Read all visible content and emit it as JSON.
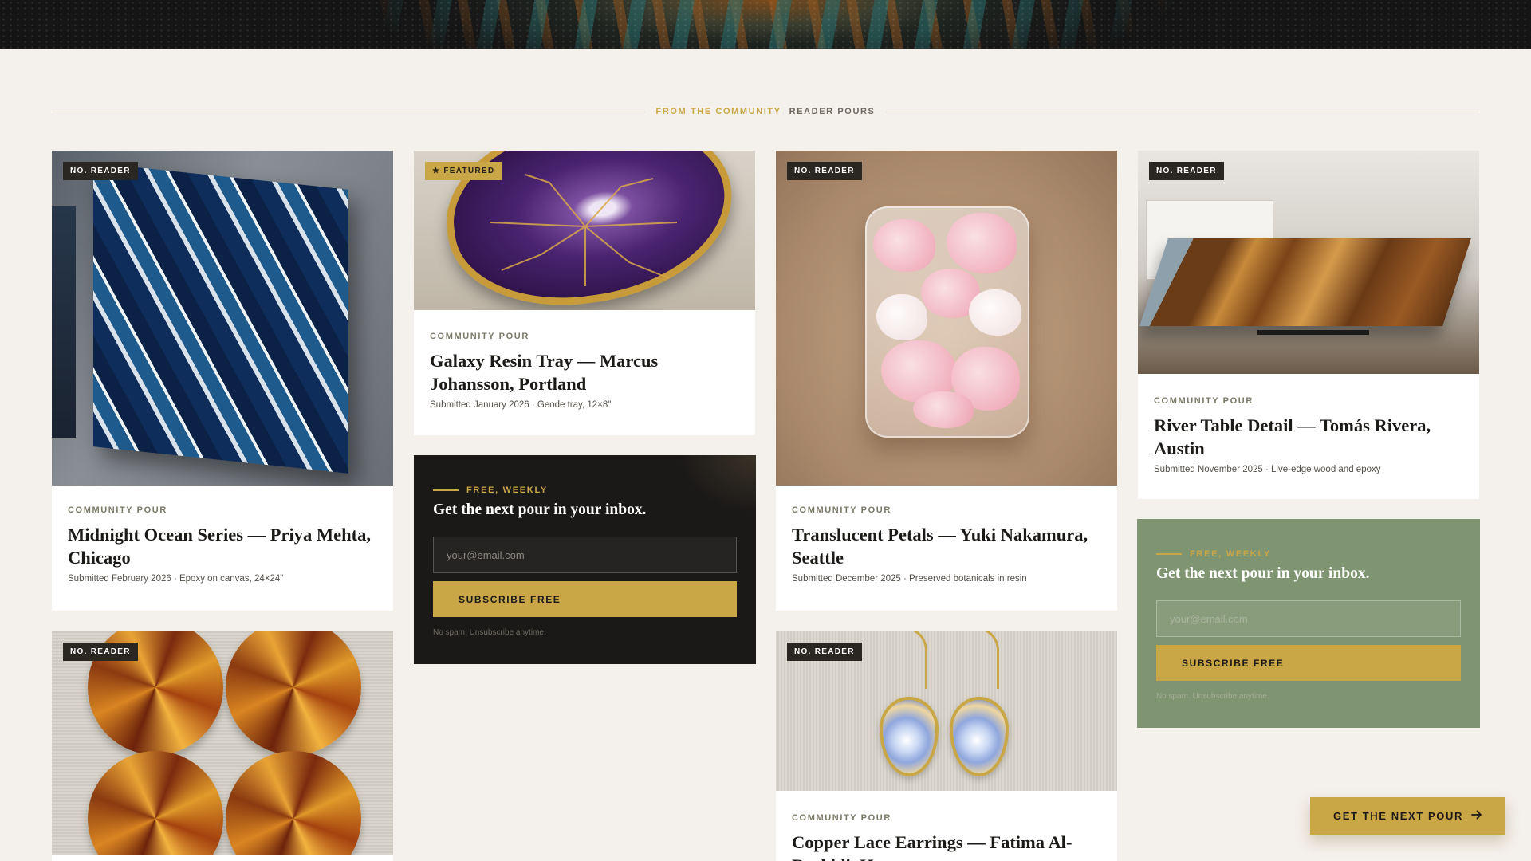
{
  "section": {
    "eyebrow": "FROM THE COMMUNITY",
    "subeyebrow": "READER POURS"
  },
  "cards": {
    "ocean": {
      "badge": "NO. READER",
      "kicker": "COMMUNITY POUR",
      "title": "Midnight Ocean Series — Priya Mehta, Chicago",
      "meta": "Submitted February 2026 · Epoxy on canvas, 24×24\""
    },
    "galaxy": {
      "badge": "★ FEATURED",
      "kicker": "COMMUNITY POUR",
      "title": "Galaxy Resin Tray — Marcus Johansson, Portland",
      "meta": "Submitted January 2026 · Geode tray, 12×8\""
    },
    "petals": {
      "badge": "NO. READER",
      "kicker": "COMMUNITY POUR",
      "title": "Translucent Petals — Yuki Nakamura, Seattle",
      "meta": "Submitted December 2025 · Preserved botanicals in resin"
    },
    "river": {
      "badge": "NO. READER",
      "kicker": "COMMUNITY POUR",
      "title": "River Table Detail — Tomás Rivera, Austin",
      "meta": "Submitted November 2025 · Live-edge wood and epoxy"
    },
    "coasters": {
      "badge": "NO. READER"
    },
    "earrings": {
      "badge": "NO. READER",
      "kicker": "COMMUNITY POUR",
      "title": "Copper Lace Earrings — Fatima Al-Rashidi, Houston"
    }
  },
  "newsletter_dark": {
    "eyebrow": "FREE, WEEKLY",
    "title": "Get the next pour in your inbox.",
    "placeholder": "your@email.com",
    "button": "SUBSCRIBE FREE",
    "note": "No spam. Unsubscribe anytime."
  },
  "newsletter_green": {
    "eyebrow": "FREE, WEEKLY",
    "title": "Get the next pour in your inbox.",
    "placeholder": "your@email.com",
    "button": "SUBSCRIBE FREE",
    "note": "No spam. Unsubscribe anytime."
  },
  "floating_cta": {
    "label": "GET THE NEXT POUR",
    "icon": "arrow-right-icon"
  },
  "colors": {
    "accent_gold": "#c9a646",
    "background": "#f4f0eb",
    "dark_panel": "#1b1918",
    "sage_panel": "#7f9470"
  }
}
